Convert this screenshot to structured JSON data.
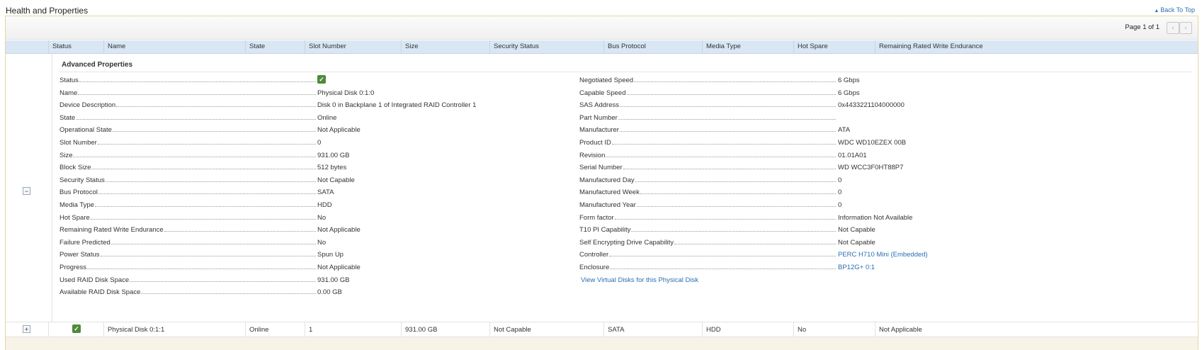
{
  "page": {
    "title": "Health and Properties",
    "back_to_top": "Back To Top"
  },
  "pager": {
    "page_info": "Page 1 of 1",
    "prev_icon": "‹",
    "next_icon": "›"
  },
  "table": {
    "columns": [
      "Status",
      "Name",
      "State",
      "Slot Number",
      "Size",
      "Security Status",
      "Bus Protocol",
      "Media Type",
      "Hot Spare",
      "Remaining Rated Write Endurance"
    ]
  },
  "expanded_row": {
    "toggle": "−",
    "section_title": "Advanced Properties",
    "left_props": [
      {
        "label": "Status",
        "value": "",
        "is_icon": true
      },
      {
        "label": "Name",
        "value": "Physical Disk 0:1:0"
      },
      {
        "label": "Device Description",
        "value": "Disk 0 in Backplane 1 of Integrated RAID Controller 1"
      },
      {
        "label": "State",
        "value": "Online"
      },
      {
        "label": "Operational State",
        "value": "Not Applicable"
      },
      {
        "label": "Slot Number",
        "value": "0"
      },
      {
        "label": "Size",
        "value": "931.00 GB"
      },
      {
        "label": "Block Size",
        "value": "512 bytes"
      },
      {
        "label": "Security Status",
        "value": "Not Capable"
      },
      {
        "label": "Bus Protocol",
        "value": "SATA"
      },
      {
        "label": "Media Type",
        "value": "HDD"
      },
      {
        "label": "Hot Spare",
        "value": "No"
      },
      {
        "label": "Remaining Rated Write Endurance",
        "value": "Not Applicable"
      },
      {
        "label": "Failure Predicted",
        "value": "No"
      },
      {
        "label": "Power Status",
        "value": "Spun Up"
      },
      {
        "label": "Progress",
        "value": "Not Applicable"
      },
      {
        "label": "Used RAID Disk Space",
        "value": "931.00 GB"
      },
      {
        "label": "Available RAID Disk Space",
        "value": "0.00 GB"
      }
    ],
    "right_props": [
      {
        "label": "Negotiated Speed",
        "value": "6 Gbps"
      },
      {
        "label": "Capable Speed",
        "value": "6 Gbps"
      },
      {
        "label": "SAS Address",
        "value": "0x4433221104000000"
      },
      {
        "label": "Part Number",
        "value": ""
      },
      {
        "label": "Manufacturer",
        "value": "ATA"
      },
      {
        "label": "Product ID",
        "value": "WDC WD10EZEX 00B"
      },
      {
        "label": "Revision",
        "value": "01.01A01"
      },
      {
        "label": "Serial Number",
        "value": "WD WCC3F0HT88P7"
      },
      {
        "label": "Manufactured Day",
        "value": "0"
      },
      {
        "label": "Manufactured Week",
        "value": "0"
      },
      {
        "label": "Manufactured Year",
        "value": "0"
      },
      {
        "label": "Form factor",
        "value": "Information Not Available"
      },
      {
        "label": "T10 PI Capability",
        "value": "Not Capable"
      },
      {
        "label": "Self Encrypting Drive Capability",
        "value": "Not Capable"
      },
      {
        "label": "Controller",
        "value": "PERC H710 Mini (Embedded)",
        "is_link": true
      },
      {
        "label": "Enclosure",
        "value": "BP12G+ 0:1",
        "is_link": true
      }
    ],
    "virtual_disks_link": "View Virtual Disks for this Physical Disk"
  },
  "collapsed_row": {
    "toggle": "+",
    "cells": [
      "",
      "Physical Disk 0:1:1",
      "Online",
      "1",
      "931.00 GB",
      "Not Capable",
      "SATA",
      "HDD",
      "No",
      "Not Applicable"
    ]
  },
  "colors": {
    "header_bg": "#d9e7f4",
    "link": "#2a6fb0",
    "status_ok": "#4f8a3a",
    "panel_border": "#e4d5a6"
  },
  "icons": {
    "status": "status-ok-icon",
    "check_glyph": "✓",
    "back_to_top": "triangle-up-icon",
    "back_to_top_glyph": "▲"
  }
}
